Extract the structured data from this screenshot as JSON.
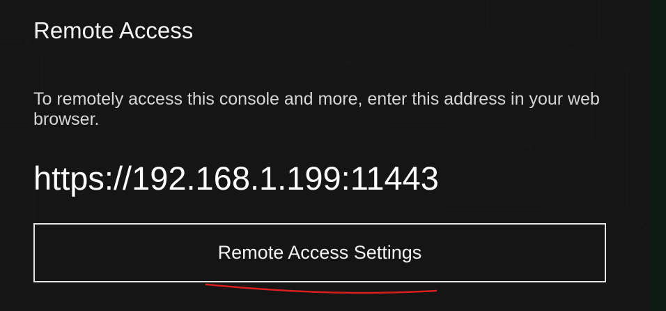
{
  "remote_access": {
    "title": "Remote Access",
    "description": "To remotely access this console and more, enter this address in your web browser.",
    "address": "https://192.168.1.199:11443",
    "settings_button_label": "Remote Access Settings"
  },
  "colors": {
    "background": "#131313",
    "panel": "#161616",
    "text": "#f2f2f2",
    "button_border": "#e6e6e6",
    "annotation_underline": "#d81e1e",
    "circuit_pattern": "#1e2a22"
  },
  "icons": {
    "background": "circuit-board-pattern",
    "annotation": "red-underline-mark"
  }
}
